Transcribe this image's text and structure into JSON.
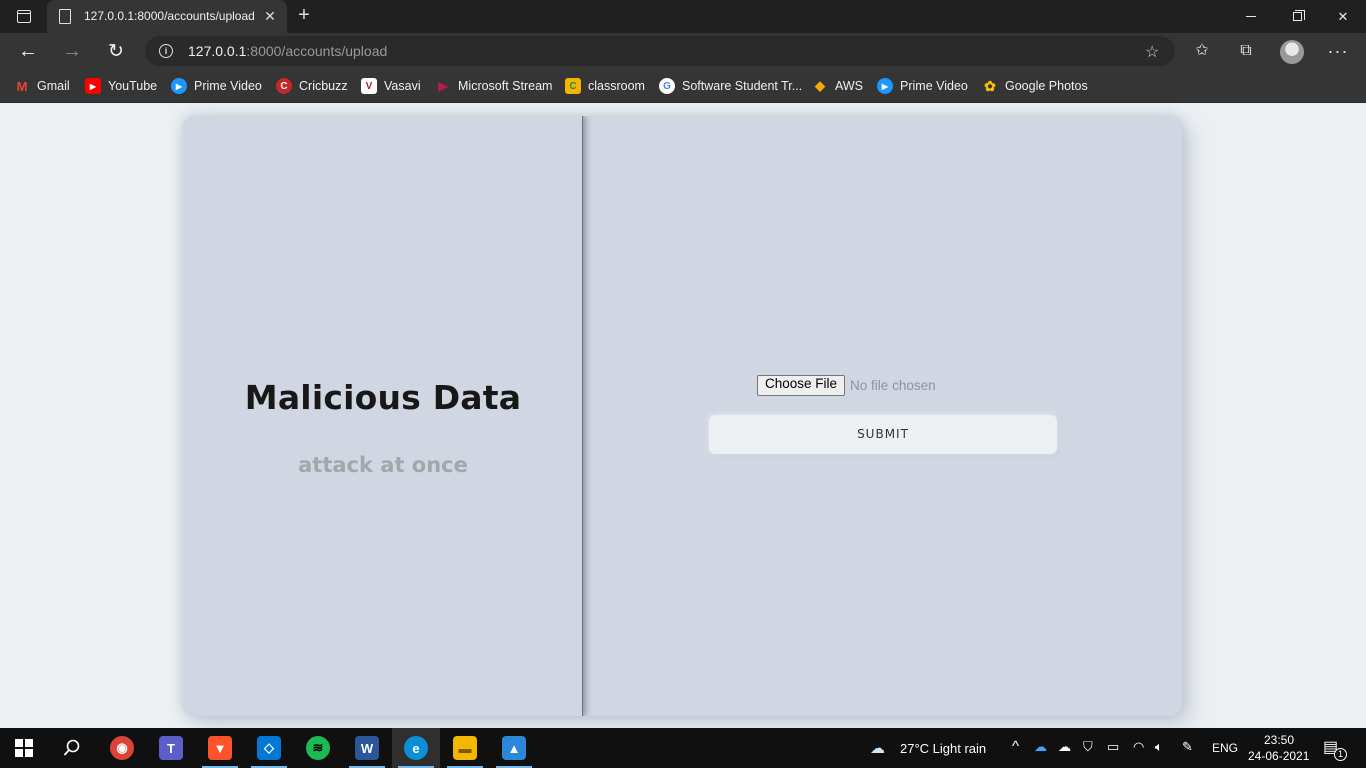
{
  "browser": {
    "tab_title": "127.0.0.1:8000/accounts/upload",
    "tab_close": "✕",
    "new_tab": "+",
    "url_host": "127.0.0.1",
    "url_rest": ":8000/accounts/upload",
    "bookmarks": [
      {
        "label": "Gmail",
        "icon": "gmail-icon",
        "color": "#ea4335",
        "glyph": "M"
      },
      {
        "label": "YouTube",
        "icon": "youtube-icon",
        "color": "#ff0000",
        "glyph": "▶"
      },
      {
        "label": "Prime Video",
        "icon": "prime-video-icon",
        "color": "#1a98ff",
        "glyph": "▶"
      },
      {
        "label": "Cricbuzz",
        "icon": "cricbuzz-icon",
        "color": "#c62828",
        "glyph": "C"
      },
      {
        "label": "Vasavi",
        "icon": "vasavi-icon",
        "color": "#ffffff",
        "glyph": "V"
      },
      {
        "label": "Microsoft Stream",
        "icon": "stream-icon",
        "color": "#bc1948",
        "glyph": "▶"
      },
      {
        "label": "classroom",
        "icon": "classroom-icon",
        "color": "#f4b400",
        "glyph": "C"
      },
      {
        "label": "Software Student Tr...",
        "icon": "google-icon",
        "color": "#ffffff",
        "glyph": "G"
      },
      {
        "label": "AWS",
        "icon": "aws-icon",
        "color": "#f7a80d",
        "glyph": "◆"
      },
      {
        "label": "Prime Video",
        "icon": "prime-video-icon",
        "color": "#1a98ff",
        "glyph": "▶"
      },
      {
        "label": "Google Photos",
        "icon": "google-photos-icon",
        "color": "#fbbc04",
        "glyph": "✿"
      }
    ]
  },
  "page": {
    "heading": "Malicious Data",
    "subheading": "attack at once",
    "file_button": "Choose File",
    "file_status": "No file chosen",
    "submit": "SUBMIT"
  },
  "taskbar": {
    "apps": [
      {
        "name": "chrome-icon",
        "color": "#db4437",
        "glyph": "◉"
      },
      {
        "name": "teams-icon",
        "color": "#5b5fc7",
        "glyph": "T"
      },
      {
        "name": "brave-icon",
        "color": "#fb542b",
        "glyph": "▼"
      },
      {
        "name": "vscode-icon",
        "color": "#0078d4",
        "glyph": "◇"
      },
      {
        "name": "spotify-icon",
        "color": "#1db954",
        "glyph": "≋"
      },
      {
        "name": "word-icon",
        "color": "#2b579a",
        "glyph": "W"
      },
      {
        "name": "edge-icon",
        "color": "#0c8fd6",
        "glyph": "e"
      },
      {
        "name": "file-explorer-icon",
        "color": "#f3b700",
        "glyph": "▬"
      },
      {
        "name": "photos-icon",
        "color": "#2b88d8",
        "glyph": "▲"
      }
    ],
    "weather": "27°C  Light rain",
    "language": "ENG",
    "time": "23:50",
    "date": "24-06-2021",
    "notifications": "1"
  }
}
